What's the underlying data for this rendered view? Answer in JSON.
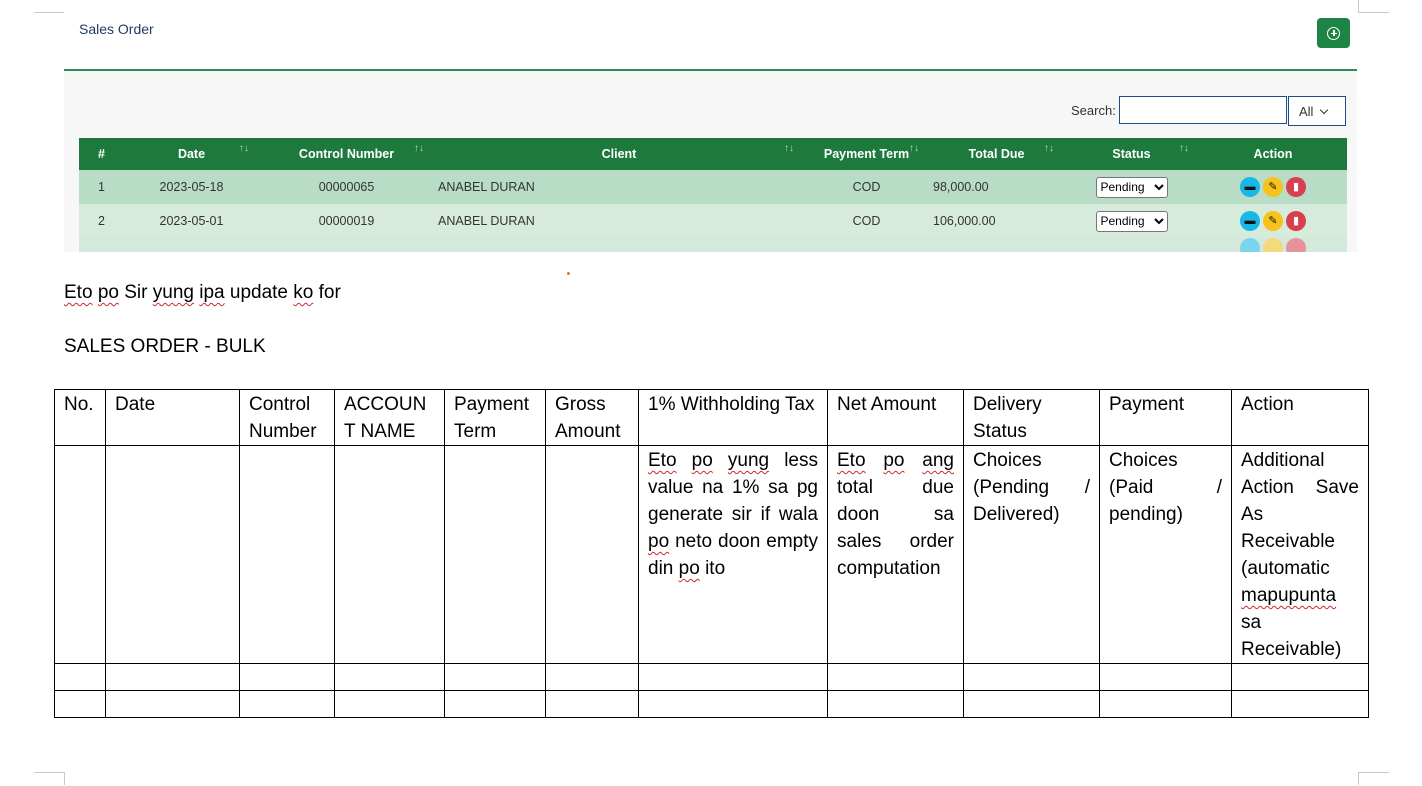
{
  "app": {
    "title": "Sales Order",
    "search_label": "Search:",
    "search_value": "",
    "filter_value": "All",
    "table": {
      "columns": [
        "#",
        "Date",
        "Control Number",
        "Client",
        "Payment Term",
        "Total Due",
        "Status",
        "Action"
      ],
      "rows": [
        {
          "no": "1",
          "date": "2023-05-18",
          "control": "00000065",
          "client": "ANABEL DURAN",
          "term": "COD",
          "total": "98,000.00",
          "status": "Pending"
        },
        {
          "no": "2",
          "date": "2023-05-01",
          "control": "00000019",
          "client": "ANABEL DURAN",
          "term": "COD",
          "total": "106,000.00",
          "status": "Pending"
        }
      ],
      "status_options": [
        "Pending",
        "Delivered"
      ],
      "action_icons": [
        "print-icon",
        "edit-icon",
        "delete-icon"
      ]
    },
    "colors": {
      "header_green": "#1e7a3c",
      "row_a": "#b8dcc6",
      "row_b": "#d7ebdd",
      "add_button": "#1e8446"
    }
  },
  "doc": {
    "line1": [
      "Eto",
      "po",
      "Sir",
      "yung",
      "ipa",
      "update",
      "ko",
      "for"
    ],
    "line2": "SALES ORDER - BULK",
    "table": {
      "headers": [
        "No.",
        "Date",
        "Control Number",
        "ACCOUNT NAME",
        "Payment Term",
        "Gross Amount",
        "1% Withholding Tax",
        "Net Amount",
        "Delivery Status",
        "Payment",
        "Action"
      ],
      "withholding_note": [
        "Eto",
        "po",
        "yung",
        "less value na 1% sa pg generate sir if wala",
        "po",
        "neto doon empty din",
        "po",
        "ito"
      ],
      "net_note": [
        "Eto",
        "po",
        "ang",
        "total due doon sa sales order computation"
      ],
      "delivery_note": "Choices (Pending / Delivered)",
      "payment_note": "Choices (Paid / pending)",
      "action_note": [
        "Additional Action Save As Receivable (automatic",
        "mapupunta",
        "sa Receivable)"
      ]
    }
  }
}
